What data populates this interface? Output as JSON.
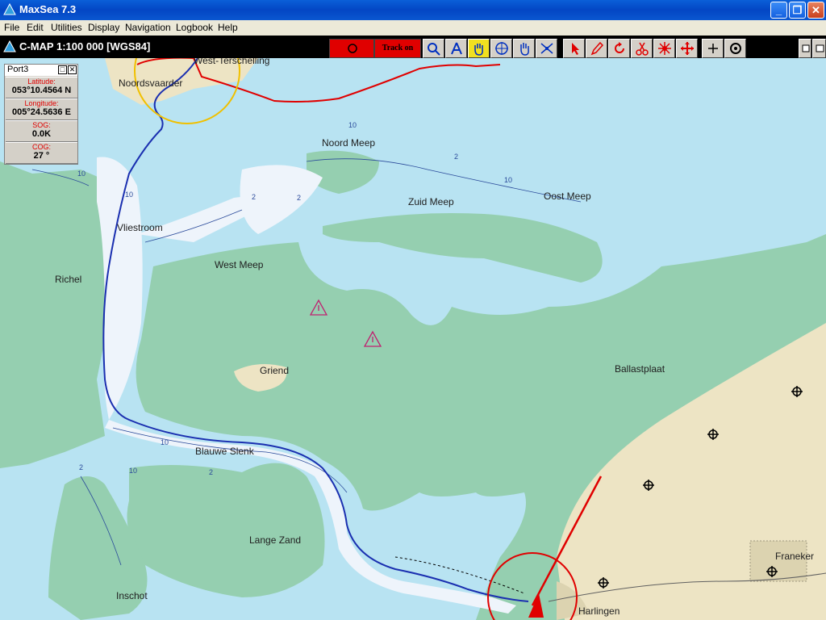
{
  "window": {
    "title": "MaxSea 7.3"
  },
  "menu": [
    "File",
    "Edit",
    "Utilities",
    "Display",
    "Navigation",
    "Logbook",
    "Help"
  ],
  "chart_header": {
    "title": "C-MAP  1:100 000 [WGS84]"
  },
  "toolbar": {
    "track_label": "Track on",
    "tools": [
      "zoom-icon",
      "compass-icon",
      "hand-icon",
      "crosshair-icon",
      "pan-icon",
      "route-icon",
      "pointer-icon",
      "pencil-icon",
      "rotate-icon",
      "scissors-icon",
      "waypoint-icon",
      "move-icon",
      "plus-icon",
      "target-icon"
    ]
  },
  "port_panel": {
    "title": "Port3",
    "latitude_label": "Latitude:",
    "latitude": "053°10.4564 N",
    "longitude_label": "Longitude:",
    "longitude": "005°24.5636 E",
    "sog_label": "SOG:",
    "sog": "0.0K",
    "cog_label": "COG:",
    "cog": "27 °"
  },
  "map_labels": {
    "west_terschelling": "West-Terschelling",
    "noordsvaarder": "Noordsvaarder",
    "noord_meep": "Noord Meep",
    "zuid_meep": "Zuid Meep",
    "oost_meep": "Oost Meep",
    "vliestroom": "Vliestroom",
    "west_meep": "West Meep",
    "richel": "Richel",
    "griend": "Griend",
    "ballastplaat": "Ballastplaat",
    "blauwe_slenk": "Blauwe Slenk",
    "lange_zand": "Lange Zand",
    "inschot": "Inschot",
    "franeker": "Franeker",
    "harlingen": "Harlingen"
  },
  "depth_labels": [
    "10",
    "2",
    "10",
    "2",
    "10",
    "2",
    "2",
    "10",
    "10",
    "2",
    "10"
  ],
  "colors": {
    "land": "#ede4c4",
    "tidal_flat": "#95cfb0",
    "shallow_water": "#b8e3f2",
    "deep_water": "#eef4fb",
    "track_red": "#e00000",
    "track_blue": "#1a2fb0"
  }
}
